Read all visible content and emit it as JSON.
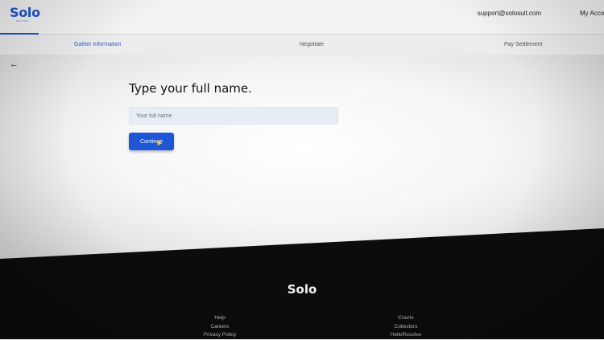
{
  "header": {
    "logo": "Solo",
    "logo_sub": "SOLO SUIT",
    "support_email": "support@solosuit.com",
    "account_label": "My Account"
  },
  "steps": [
    {
      "label": "Gather Information",
      "active": true
    },
    {
      "label": "Negotiate",
      "active": false
    },
    {
      "label": "Pay Settlement",
      "active": false
    }
  ],
  "form": {
    "back_icon": "arrow-left-icon",
    "title": "Type your full name.",
    "input_placeholder": "Your full name",
    "input_value": "",
    "continue_label": "Continue"
  },
  "footer": {
    "logo": "Solo",
    "col1": [
      "Help",
      "Careers",
      "Privacy Policy"
    ],
    "col2": [
      "Courts",
      "Collectors",
      "HelloResolve"
    ]
  },
  "colors": {
    "brand_blue": "#1f56d6",
    "footer_bg": "#0c0c0c"
  }
}
